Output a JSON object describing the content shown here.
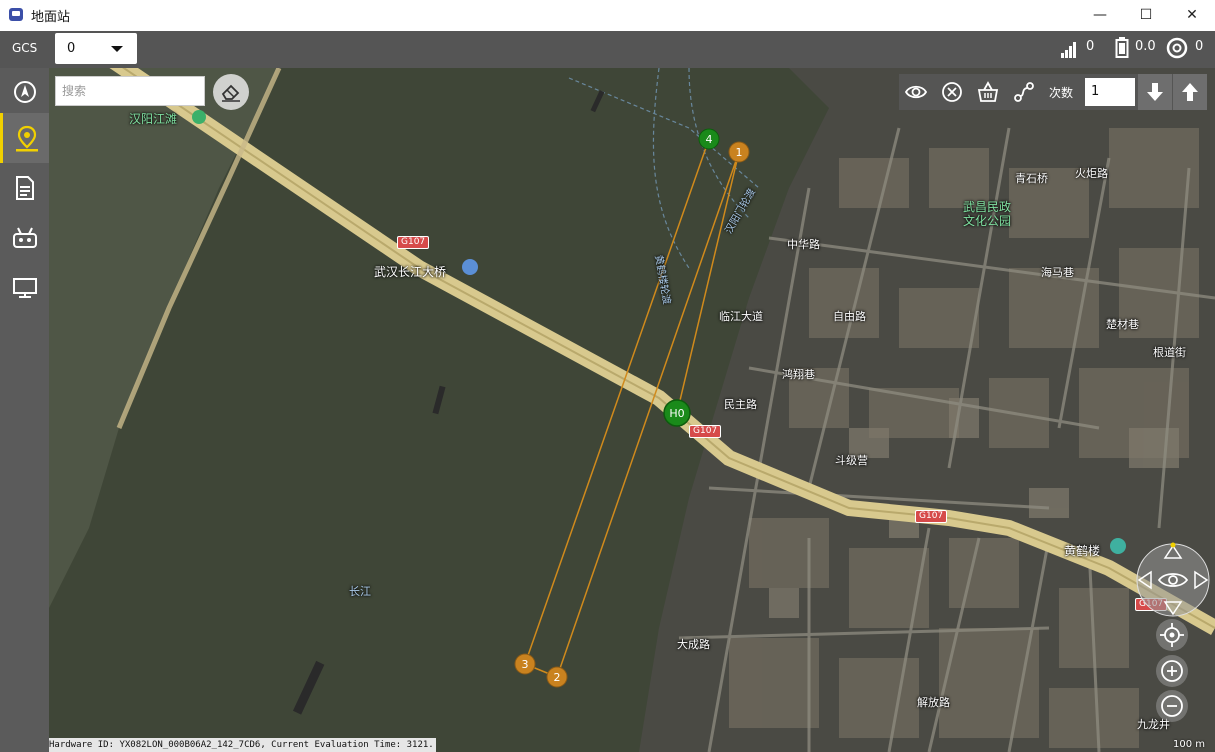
{
  "window": {
    "title": "地面站",
    "minimize": "—",
    "maximize": "☐",
    "close": "✕"
  },
  "toolbar": {
    "gcs_label": "GCS",
    "vehicle_select": "0",
    "signal_value": "0",
    "battery_value": "0.0",
    "gps_value": "0"
  },
  "sidebar": {
    "items": [
      {
        "name": "compass",
        "icon": "compass-icon"
      },
      {
        "name": "plan",
        "icon": "map-pin-icon",
        "active": true
      },
      {
        "name": "document",
        "icon": "document-icon"
      },
      {
        "name": "vehicle",
        "icon": "robot-icon"
      },
      {
        "name": "monitor",
        "icon": "monitor-icon"
      }
    ]
  },
  "map": {
    "search_placeholder": "搜索",
    "toolbar": {
      "count_label": "次数",
      "count_value": "1"
    },
    "hardware_text": "Hardware ID: YX082LON_000B06A2_142_7CD6, Current Evaluation Time: 3121.",
    "scale_label": "100 m",
    "waypoints": [
      {
        "label": "H0",
        "type": "home",
        "color": "#1a8a1a"
      },
      {
        "label": "1",
        "color": "#c9821f"
      },
      {
        "label": "2",
        "color": "#c9821f"
      },
      {
        "label": "3",
        "color": "#c9821f"
      },
      {
        "label": "4",
        "color": "#1a8a1a"
      }
    ],
    "places": [
      {
        "text": "汉阳江滩"
      },
      {
        "text": "武汉长江大桥"
      },
      {
        "text": "长江"
      },
      {
        "text": "武昌民政"
      },
      {
        "text": "文化公园"
      },
      {
        "text": "黄鹤楼"
      },
      {
        "text": "中华路"
      },
      {
        "text": "临江大道"
      },
      {
        "text": "大成路"
      },
      {
        "text": "民主路"
      },
      {
        "text": "斗级营"
      },
      {
        "text": "自由路"
      },
      {
        "text": "火炬路"
      },
      {
        "text": "青石桥"
      },
      {
        "text": "海马巷"
      },
      {
        "text": "楚材巷"
      },
      {
        "text": "根道街"
      },
      {
        "text": "鸿翔巷"
      },
      {
        "text": "解放路"
      },
      {
        "text": "九龙井"
      },
      {
        "text": "汉阳门轮渡"
      },
      {
        "text": "黄鹤楼轮渡"
      }
    ],
    "roads": [
      "G107",
      "G107",
      "G107",
      "G107"
    ]
  },
  "colors": {
    "accent": "#f1d000",
    "route": "#d08a1c",
    "home": "#1a8a1a"
  }
}
